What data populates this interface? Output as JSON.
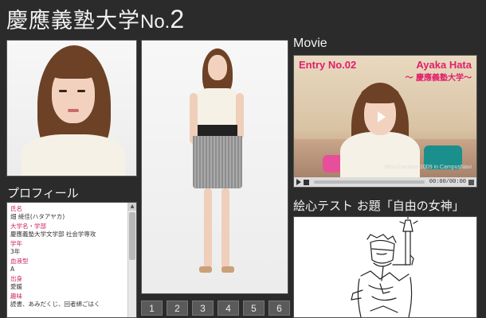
{
  "header": {
    "title_main": "慶應義塾大学",
    "title_no": "No.",
    "title_num": "2"
  },
  "profile": {
    "heading": "プロフィール",
    "fields": [
      {
        "label": "氏名",
        "value": "畑 綾佳(ハタアヤカ)"
      },
      {
        "label": "大学名・学部",
        "value": "慶應義塾大学文学部 社会学専攻"
      },
      {
        "label": "学年",
        "value": "3年"
      },
      {
        "label": "血液型",
        "value": "A"
      },
      {
        "label": "出身",
        "value": "愛媛"
      },
      {
        "label": "趣味",
        "value": "読書、あみだくじ、回者綿ごはく"
      }
    ]
  },
  "pager": {
    "pages": [
      "1",
      "2",
      "3",
      "4",
      "5",
      "6"
    ]
  },
  "movie": {
    "heading": "Movie",
    "entry": "Entry No.02",
    "name": "Ayaka Hata",
    "school": "～ 慶應義塾大学～",
    "credit": "Miss Campus 2009 in CampusNavi",
    "time": "00:00/00:00"
  },
  "drawing": {
    "heading": "絵心テスト お題「自由の女神」"
  },
  "colors": {
    "background": "#2b2b2b",
    "accent_pink": "#e0206a",
    "label_pink": "#cc2266"
  }
}
